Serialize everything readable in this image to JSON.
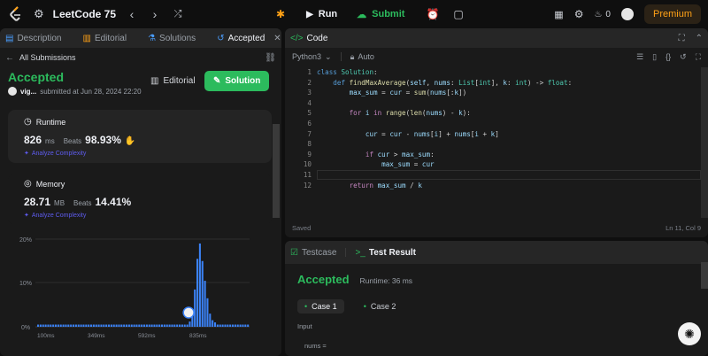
{
  "topbar": {
    "title": "LeetCode 75",
    "run_label": "Run",
    "submit_label": "Submit",
    "streak": "0",
    "premium_label": "Premium"
  },
  "left_panel": {
    "tabs": [
      {
        "label": "Description"
      },
      {
        "label": "Editorial"
      },
      {
        "label": "Solutions"
      },
      {
        "label": "Accepted"
      }
    ],
    "back_label": "All Submissions",
    "status": "Accepted",
    "user": "vig...",
    "submitted_text": "submitted at Jun 28, 2024 22:20",
    "editorial_btn": "Editorial",
    "solution_btn": "Solution",
    "runtime": {
      "title": "Runtime",
      "value": "826",
      "unit": "ms",
      "beats_label": "Beats",
      "beats_value": "98.93%",
      "analyze": "Analyze Complexity"
    },
    "memory": {
      "title": "Memory",
      "value": "28.71",
      "unit": "MB",
      "beats_label": "Beats",
      "beats_value": "14.41%",
      "analyze": "Analyze Complexity"
    }
  },
  "chart_data": {
    "type": "bar",
    "ylabels": [
      "20%",
      "10%",
      "0%"
    ],
    "ylim": [
      0,
      20
    ],
    "xlabels": [
      "100ms",
      "349ms",
      "592ms",
      "835ms"
    ],
    "values": [
      0.5,
      0.5,
      0.5,
      0.5,
      0.5,
      0.5,
      0.5,
      0.5,
      0.5,
      0.5,
      0.5,
      0.5,
      0.5,
      0.5,
      0.5,
      0.5,
      0.5,
      0.5,
      0.5,
      0.5,
      0.5,
      0.5,
      0.5,
      0.5,
      0.5,
      0.5,
      0.5,
      0.5,
      0.5,
      0.5,
      0.5,
      0.5,
      0.5,
      0.5,
      0.5,
      0.5,
      0.5,
      0.5,
      0.5,
      0.5,
      0.5,
      0.5,
      0.5,
      0.5,
      0.5,
      0.5,
      0.5,
      0.5,
      0.5,
      0.5,
      0.5,
      0.5,
      0.5,
      0.5,
      0.5,
      0.5,
      0.5,
      0.5,
      0.5,
      0.5,
      1.2,
      3.5,
      8.5,
      15.5,
      19,
      15,
      10.5,
      6.5,
      3,
      1.5,
      1,
      0.5,
      0.5,
      0.5,
      0.5,
      0.5,
      0.5,
      0.5,
      0.5,
      0.5,
      0.5,
      0.5,
      0.5,
      0.5
    ],
    "highlight_index": 62,
    "bar_color": "#3b82f6",
    "grid": true
  },
  "code_panel": {
    "tab_label": "Code",
    "language": "Python3",
    "auto_label": "Auto",
    "line_numbers": [
      "1",
      "2",
      "3",
      "4",
      "5",
      "6",
      "7",
      "8",
      "9",
      "10",
      "11",
      "12"
    ],
    "status": "Saved",
    "cursor": "Ln 11, Col 9"
  },
  "test_panel": {
    "tab_testcase": "Testcase",
    "tab_result": "Test Result",
    "status": "Accepted",
    "runtime": "Runtime: 36 ms",
    "case1": "Case 1",
    "case2": "Case 2",
    "input_label": "Input",
    "nums_label": "nums ="
  }
}
